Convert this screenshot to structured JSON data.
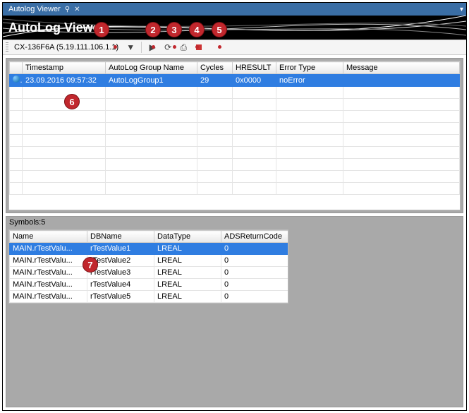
{
  "tab": {
    "title": "Autolog Viewer"
  },
  "title": "AutoLog Viewer",
  "toolbar": {
    "device": "CX-136F6A (5.19.111.106.1.1)"
  },
  "upper": {
    "headers": [
      "",
      "Timestamp",
      "AutoLog Group Name",
      "Cycles",
      "HRESULT",
      "Error Type",
      "Message"
    ],
    "rows": [
      {
        "icon": true,
        "timestamp": "23.09.2016 09:57:32",
        "group": "AutoLogGroup1",
        "cycles": "29",
        "hresult": "0x0000",
        "errortype": "noError",
        "message": ""
      }
    ],
    "blank_rows": 9
  },
  "lower": {
    "label": "Symbols:5",
    "headers": [
      "Name",
      "DBName",
      "DataType",
      "ADSReturnCode"
    ],
    "rows": [
      {
        "name": "MAIN.rTestValu...",
        "dbname": "rTestValue1",
        "datatype": "LREAL",
        "ads": "0",
        "selected": true
      },
      {
        "name": "MAIN.rTestValu...",
        "dbname": "rTestValue2",
        "datatype": "LREAL",
        "ads": "0"
      },
      {
        "name": "MAIN.rTestValu...",
        "dbname": "rTestValue3",
        "datatype": "LREAL",
        "ads": "0"
      },
      {
        "name": "MAIN.rTestValu...",
        "dbname": "rTestValue4",
        "datatype": "LREAL",
        "ads": "0"
      },
      {
        "name": "MAIN.rTestValu...",
        "dbname": "rTestValue5",
        "datatype": "LREAL",
        "ads": "0"
      }
    ]
  },
  "callouts": {
    "1": "1",
    "2": "2",
    "3": "3",
    "4": "4",
    "5": "5",
    "6": "6",
    "7": "7"
  }
}
